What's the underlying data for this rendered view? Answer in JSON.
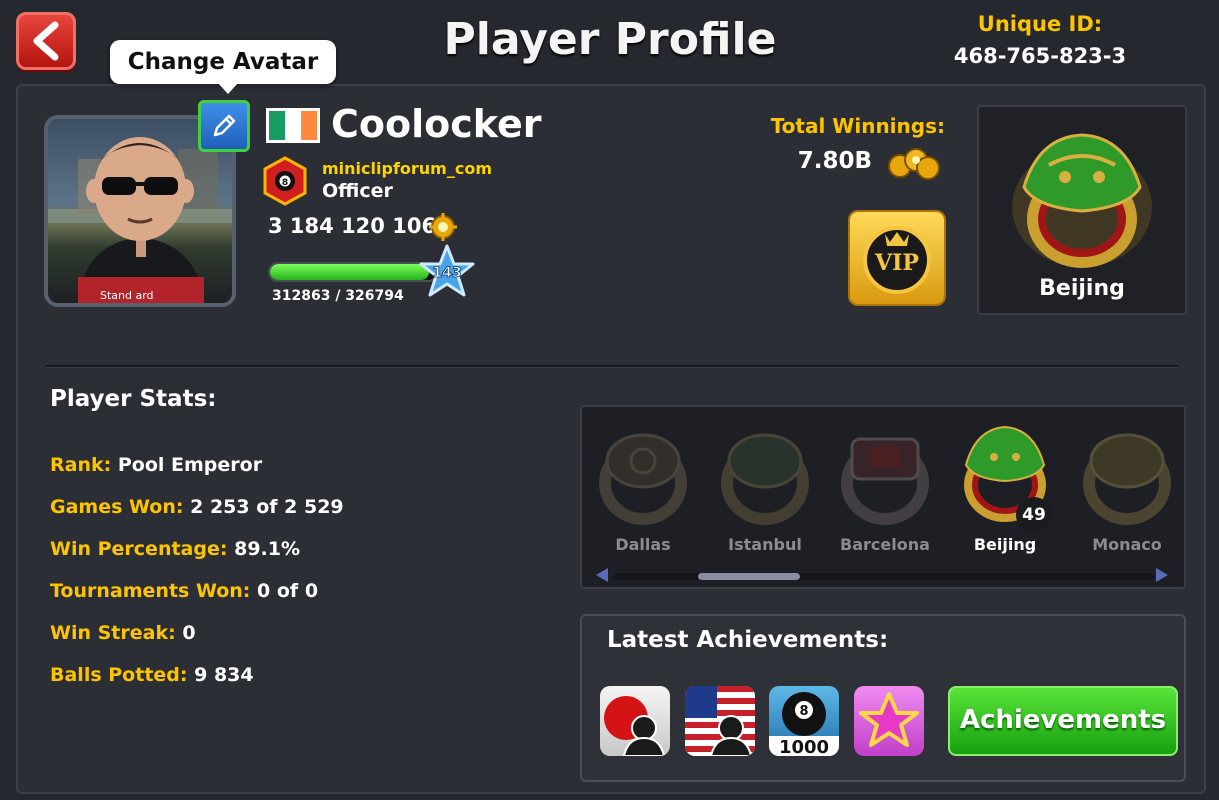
{
  "header": {
    "title": "Player Profile",
    "unique_id_label": "Unique ID:",
    "unique_id_value": "468-765-823-3"
  },
  "tooltip": "Change Avatar",
  "player": {
    "name": "Coolocker",
    "flag": "ireland-flag",
    "flag_colors": [
      "#169b62",
      "#ffffff",
      "#ff883e"
    ],
    "club_name": "miniclipforum_com",
    "club_role": "Officer",
    "club_badge_text": "8",
    "coins": "3 184 120 106",
    "level": "143",
    "xp_text": "312863 / 326794",
    "xp_fraction": 0.957
  },
  "winnings": {
    "label": "Total Winnings:",
    "value": "7.80B"
  },
  "vip_text": "VIP",
  "featured_ring": "Beijing",
  "stats": {
    "title": "Player Stats:",
    "rows": [
      {
        "label": "Rank:",
        "value": "Pool Emperor"
      },
      {
        "label": "Games Won:",
        "value": "2 253 of 2 529"
      },
      {
        "label": "Win Percentage:",
        "value": "89.1%"
      },
      {
        "label": "Tournaments Won:",
        "value": "0 of 0"
      },
      {
        "label": "Win Streak:",
        "value": "0"
      },
      {
        "label": "Balls Potted:",
        "value": "9 834"
      }
    ]
  },
  "rings": [
    {
      "name": "Dallas",
      "owned": false
    },
    {
      "name": "Istanbul",
      "owned": false
    },
    {
      "name": "Barcelona",
      "owned": false
    },
    {
      "name": "Beijing",
      "owned": true,
      "count": "49"
    },
    {
      "name": "Monaco",
      "owned": false
    }
  ],
  "achievements": {
    "title": "Latest Achievements:",
    "button_label": "Achievements",
    "icons": [
      "japan-player-icon",
      "usa-player-icon",
      "eight-ball-1000-icon",
      "pink-star-icon"
    ],
    "eight_ball_count": "1000",
    "eight_ball_text": "8"
  },
  "colors": {
    "accent_yellow": "#ffc400",
    "background": "#26282f",
    "green_button": "#17a00f",
    "back_button": "#d0251b"
  }
}
